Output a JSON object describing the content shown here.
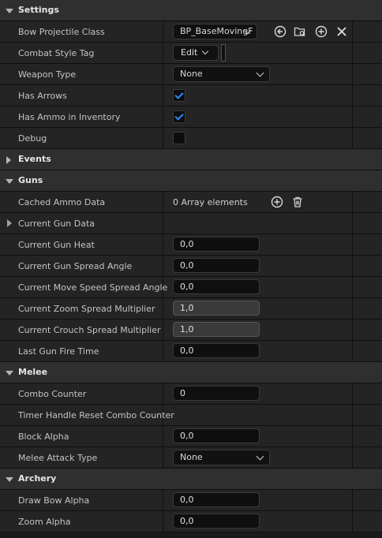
{
  "sections": {
    "settings": {
      "title": "Settings"
    },
    "events": {
      "title": "Events"
    },
    "guns": {
      "title": "Guns"
    },
    "melee": {
      "title": "Melee"
    },
    "archery": {
      "title": "Archery"
    }
  },
  "settings": {
    "bow_projectile_class": {
      "label": "Bow Projectile Class",
      "value": "BP_BaseMovingF"
    },
    "combat_style_tag": {
      "label": "Combat Style Tag",
      "button": "Edit"
    },
    "weapon_type": {
      "label": "Weapon Type",
      "value": "None"
    },
    "has_arrows": {
      "label": "Has Arrows",
      "checked": true
    },
    "has_ammo": {
      "label": "Has Ammo in Inventory",
      "checked": true
    },
    "debug": {
      "label": "Debug",
      "checked": false
    }
  },
  "guns": {
    "cached_ammo": {
      "label": "Cached Ammo Data",
      "value": "0 Array elements"
    },
    "current_gun_data": {
      "label": "Current Gun Data"
    },
    "gun_heat": {
      "label": "Current Gun Heat",
      "value": "0,0"
    },
    "spread_angle": {
      "label": "Current Gun Spread Angle",
      "value": "0,0"
    },
    "move_speed_spread": {
      "label": "Current Move Speed Spread Angle",
      "value": "0,0"
    },
    "zoom_spread": {
      "label": "Current Zoom Spread Multiplier",
      "value": "1,0"
    },
    "crouch_spread": {
      "label": "Current Crouch Spread Multiplier",
      "value": "1,0"
    },
    "last_fire": {
      "label": "Last Gun Fire Time",
      "value": "0,0"
    }
  },
  "melee": {
    "combo_counter": {
      "label": "Combo Counter",
      "value": "0"
    },
    "timer_handle": {
      "label": "Timer Handle Reset Combo Counter"
    },
    "block_alpha": {
      "label": "Block Alpha",
      "value": "0,0"
    },
    "attack_type": {
      "label": "Melee Attack Type",
      "value": "None"
    }
  },
  "archery": {
    "draw_bow_alpha": {
      "label": "Draw Bow Alpha",
      "value": "0,0"
    },
    "zoom_alpha": {
      "label": "Zoom Alpha",
      "value": "0,0"
    }
  }
}
